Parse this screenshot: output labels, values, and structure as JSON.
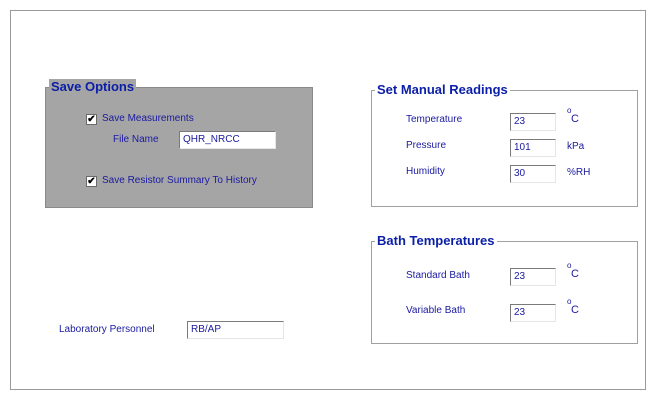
{
  "save_options": {
    "title": "Save Options",
    "save_measurements_label": "Save Measurements",
    "save_measurements_checked": true,
    "file_name_label": "File Name",
    "file_name_value": "QHR_NRCC",
    "save_summary_label": "Save Resistor Summary To History",
    "save_summary_checked": true
  },
  "manual_readings": {
    "title": "Set Manual Readings",
    "temperature_label": "Temperature",
    "temperature_value": "23",
    "pressure_label": "Pressure",
    "pressure_value": "101",
    "pressure_unit": "kPa",
    "humidity_label": "Humidity",
    "humidity_value": "30",
    "humidity_unit": "%RH"
  },
  "bath_temperatures": {
    "title": "Bath Temperatures",
    "standard_label": "Standard Bath",
    "standard_value": "23",
    "variable_label": "Variable Bath",
    "variable_value": "23"
  },
  "units": {
    "degree": "o",
    "celsius": "C",
    "check": "✔"
  },
  "personnel": {
    "label": "Laboratory Personnel",
    "value": "RB/AP"
  },
  "colors": {
    "title_text": "#0a1ea8",
    "label_text": "#1a1aa0",
    "save_panel_bg": "#a5a5a5"
  }
}
